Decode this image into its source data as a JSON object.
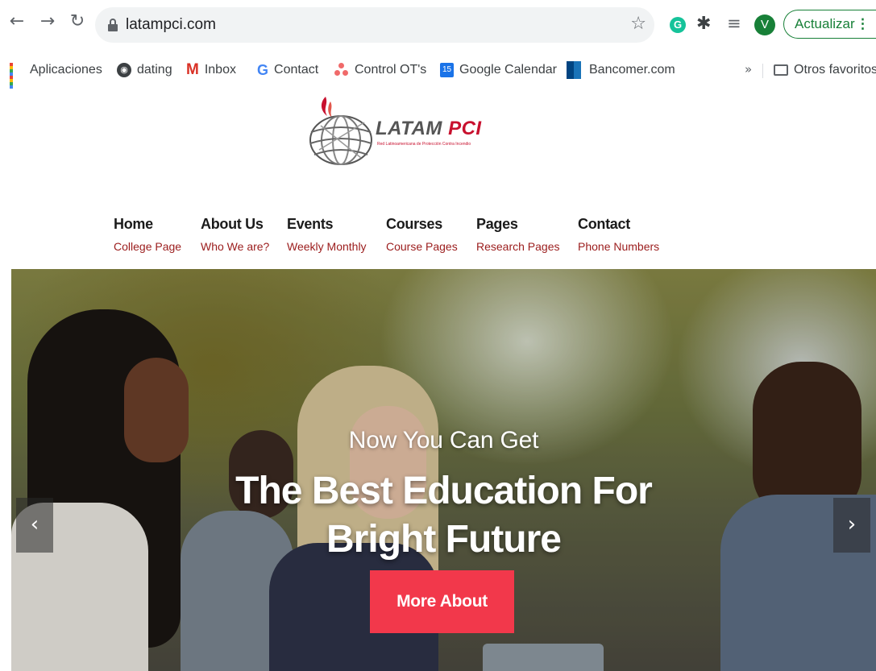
{
  "browser": {
    "url": "latampci.com",
    "update_label": "Actualizar",
    "avatar_letter": "V",
    "extension_letter": "G",
    "icons": [
      "back-icon",
      "forward-icon",
      "reload-icon",
      "lock-icon",
      "star-icon",
      "grammarly-icon",
      "puzzle-icon",
      "media-queue-icon",
      "kebab-menu-icon"
    ]
  },
  "bookmarks": {
    "items": [
      {
        "label": "Aplicaciones",
        "icon": "apps-grid-icon"
      },
      {
        "label": "dating",
        "icon": "globe-icon"
      },
      {
        "label": "Inbox",
        "icon": "gmail-icon"
      },
      {
        "label": "Contact",
        "icon": "google-icon"
      },
      {
        "label": "Control OT's",
        "icon": "asana-icon"
      },
      {
        "label": "Google Calendar",
        "icon": "calendar-icon"
      },
      {
        "label": "Bancomer.com",
        "icon": "bbva-icon"
      }
    ],
    "overflow": "»",
    "other_label": "Otros favoritos",
    "calendar_day": "15"
  },
  "site": {
    "logo_main": "LATAM",
    "logo_accent": "PCI",
    "logo_tagline": "Red Latinoamericana de Protección Contra Incendio",
    "menu": [
      {
        "label": "Home",
        "sub": "College Page"
      },
      {
        "label": "About Us",
        "sub": "Who We are?"
      },
      {
        "label": "Events",
        "sub": "Weekly Monthly"
      },
      {
        "label": "Courses",
        "sub": "Course Pages"
      },
      {
        "label": "Pages",
        "sub": "Research Pages"
      },
      {
        "label": "Contact",
        "sub": "Phone Numbers"
      }
    ]
  },
  "hero": {
    "subtitle": "Now You Can Get",
    "title_line1": "The Best Education For",
    "title_line2": "Bright Future",
    "button_label": "More About",
    "prev_arrow": "‹",
    "next_arrow": "›"
  },
  "colors": {
    "accent_red": "#f2384b",
    "menu_sub": "#9b1c1c",
    "update_green": "#188038"
  }
}
